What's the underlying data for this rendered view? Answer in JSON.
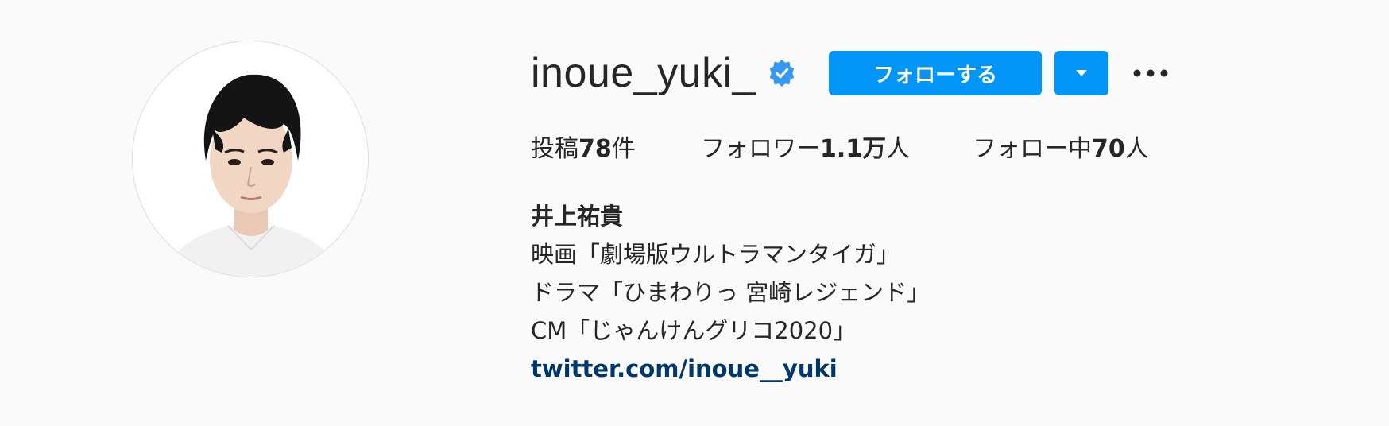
{
  "profile": {
    "username": "inoue_yuki_",
    "verified_icon": "verified-badge-icon",
    "avatar_icon": "profile-photo"
  },
  "actions": {
    "follow_label": "フォローする",
    "dropdown_icon": "triangle-down-icon",
    "more_icon": "ellipsis-icon"
  },
  "stats": {
    "posts_prefix": "投稿",
    "posts_count": "78",
    "posts_suffix": "件",
    "followers_prefix": "フォロワー",
    "followers_count": "1.1万",
    "followers_suffix": "人",
    "following_prefix": "フォロー中",
    "following_count": "70",
    "following_suffix": "人"
  },
  "bio": {
    "full_name": "井上祐貴",
    "lines": [
      "映画「劇場版ウルトラマンタイガ」",
      "ドラマ「ひまわりっ 宮崎レジェンド」",
      "CM「じゃんけんグリコ2020」"
    ],
    "link": "twitter.com/inoue__yuki"
  },
  "colors": {
    "accent": "#0095f6",
    "link": "#00376b",
    "background": "#fafafa",
    "text": "#262626"
  }
}
